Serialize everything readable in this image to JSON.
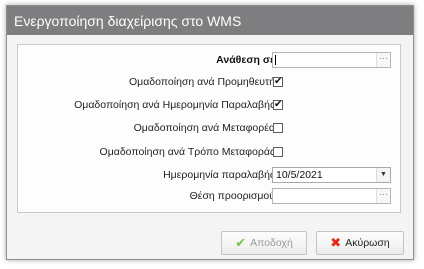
{
  "window": {
    "title": "Ενεργοποίηση διαχείρισης στο WMS"
  },
  "form": {
    "assign_to": {
      "label": "Ανάθεση σε",
      "value": "",
      "button": "···"
    },
    "group_supplier": {
      "label": "Ομαδοποίηση ανά Προμηθευτή",
      "checked": true,
      "mark": "✔"
    },
    "group_receipt_date": {
      "label": "Ομαδοποίηση ανά Ημερομηνία Παραλαβής",
      "checked": true,
      "mark": "✔"
    },
    "group_carrier": {
      "label": "Ομαδοποίηση ανά Μεταφορέα",
      "checked": false,
      "mark": ""
    },
    "group_transport_mode": {
      "label": "Ομαδοποίηση ανά Τρόπο Μεταφοράς",
      "checked": false,
      "mark": ""
    },
    "receipt_date": {
      "label": "Ημερομηνία παραλαβής",
      "value": "10/5/2021",
      "dropdown": "▼"
    },
    "destination": {
      "label": "Θέση προορισμού",
      "value": "",
      "button": "···"
    }
  },
  "buttons": {
    "ok": {
      "label": "Αποδοχή",
      "icon": "check-icon",
      "enabled": false
    },
    "cancel": {
      "label": "Ακύρωση",
      "icon": "x-icon",
      "enabled": true
    }
  },
  "icons": {
    "check": "✔",
    "x": "✖"
  },
  "colors": {
    "titlebar": "#7e7e80",
    "check_green": "#7cc043",
    "cancel_red": "#e02a1b"
  }
}
